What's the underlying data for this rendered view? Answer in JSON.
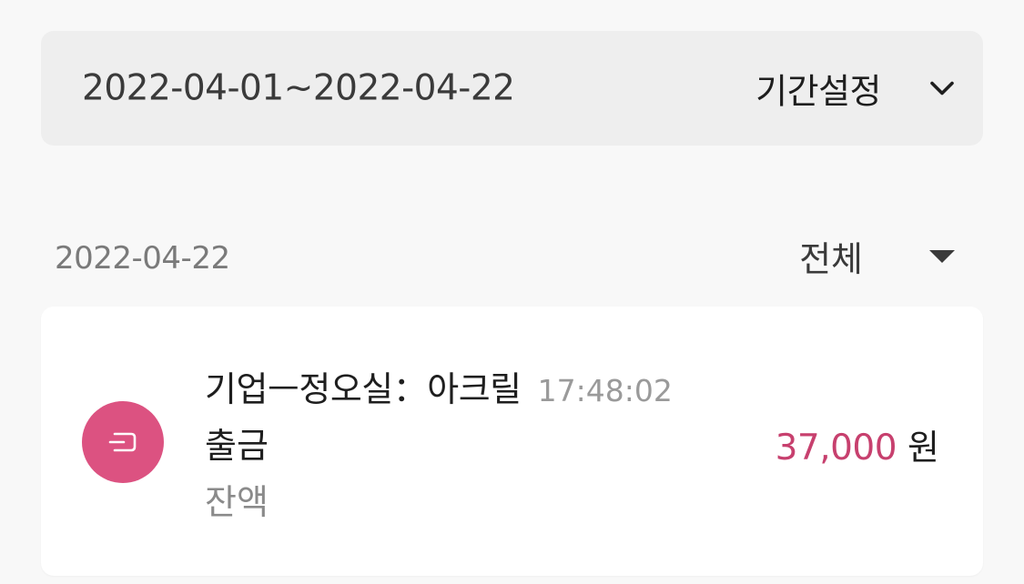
{
  "period_bar": {
    "range_text": "2022-04-01~2022-04-22",
    "setting_label": "기간설정",
    "chevron_icon": "chevron-down-icon"
  },
  "list_header": {
    "date": "2022-04-22",
    "filter_label": "전체",
    "filter_icon": "caret-down-icon"
  },
  "transactions": [
    {
      "icon": "withdraw-icon",
      "icon_color": "#dc5281",
      "title": "기업ㅡ정오실：아크릴",
      "time": "17:48:02",
      "type": "출금",
      "balance_label": "잔액",
      "amount": "37,000",
      "unit": "원",
      "amount_color": "#c7406e"
    }
  ]
}
